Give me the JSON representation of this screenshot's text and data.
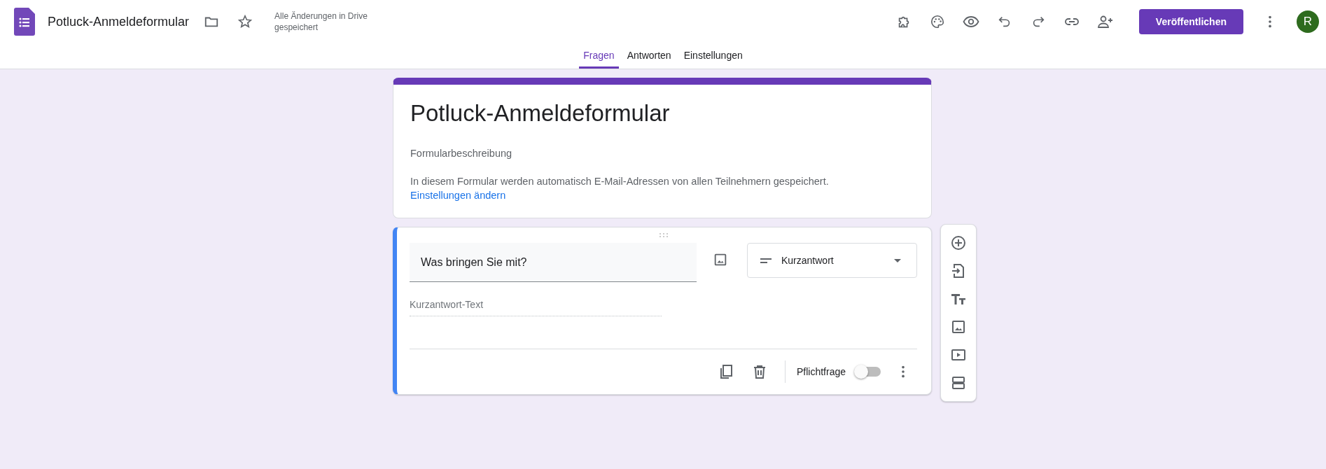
{
  "app": {
    "title": "Potluck-Anmeldeformular",
    "save_status": "Alle Änderungen in Drive gespeichert",
    "publish_button": "Veröffentlichen",
    "avatar": "R"
  },
  "tabs": [
    {
      "label": "Fragen",
      "selected": true
    },
    {
      "label": "Antworten",
      "selected": false
    },
    {
      "label": "Einstellungen",
      "selected": false
    }
  ],
  "form": {
    "title": "Potluck-Anmeldeformular",
    "description_placeholder": "Formularbeschreibung",
    "notice": "In diesem Formular werden automatisch E-Mail-Adressen von allen Teilnehmern gespeichert.",
    "notice_link": "Einstellungen ändern"
  },
  "question": {
    "title": "Was bringen Sie mit?",
    "type": "Kurzantwort",
    "answer_placeholder": "Kurzantwort-Text",
    "required_label": "Pflichtfrage",
    "required": false
  }
}
